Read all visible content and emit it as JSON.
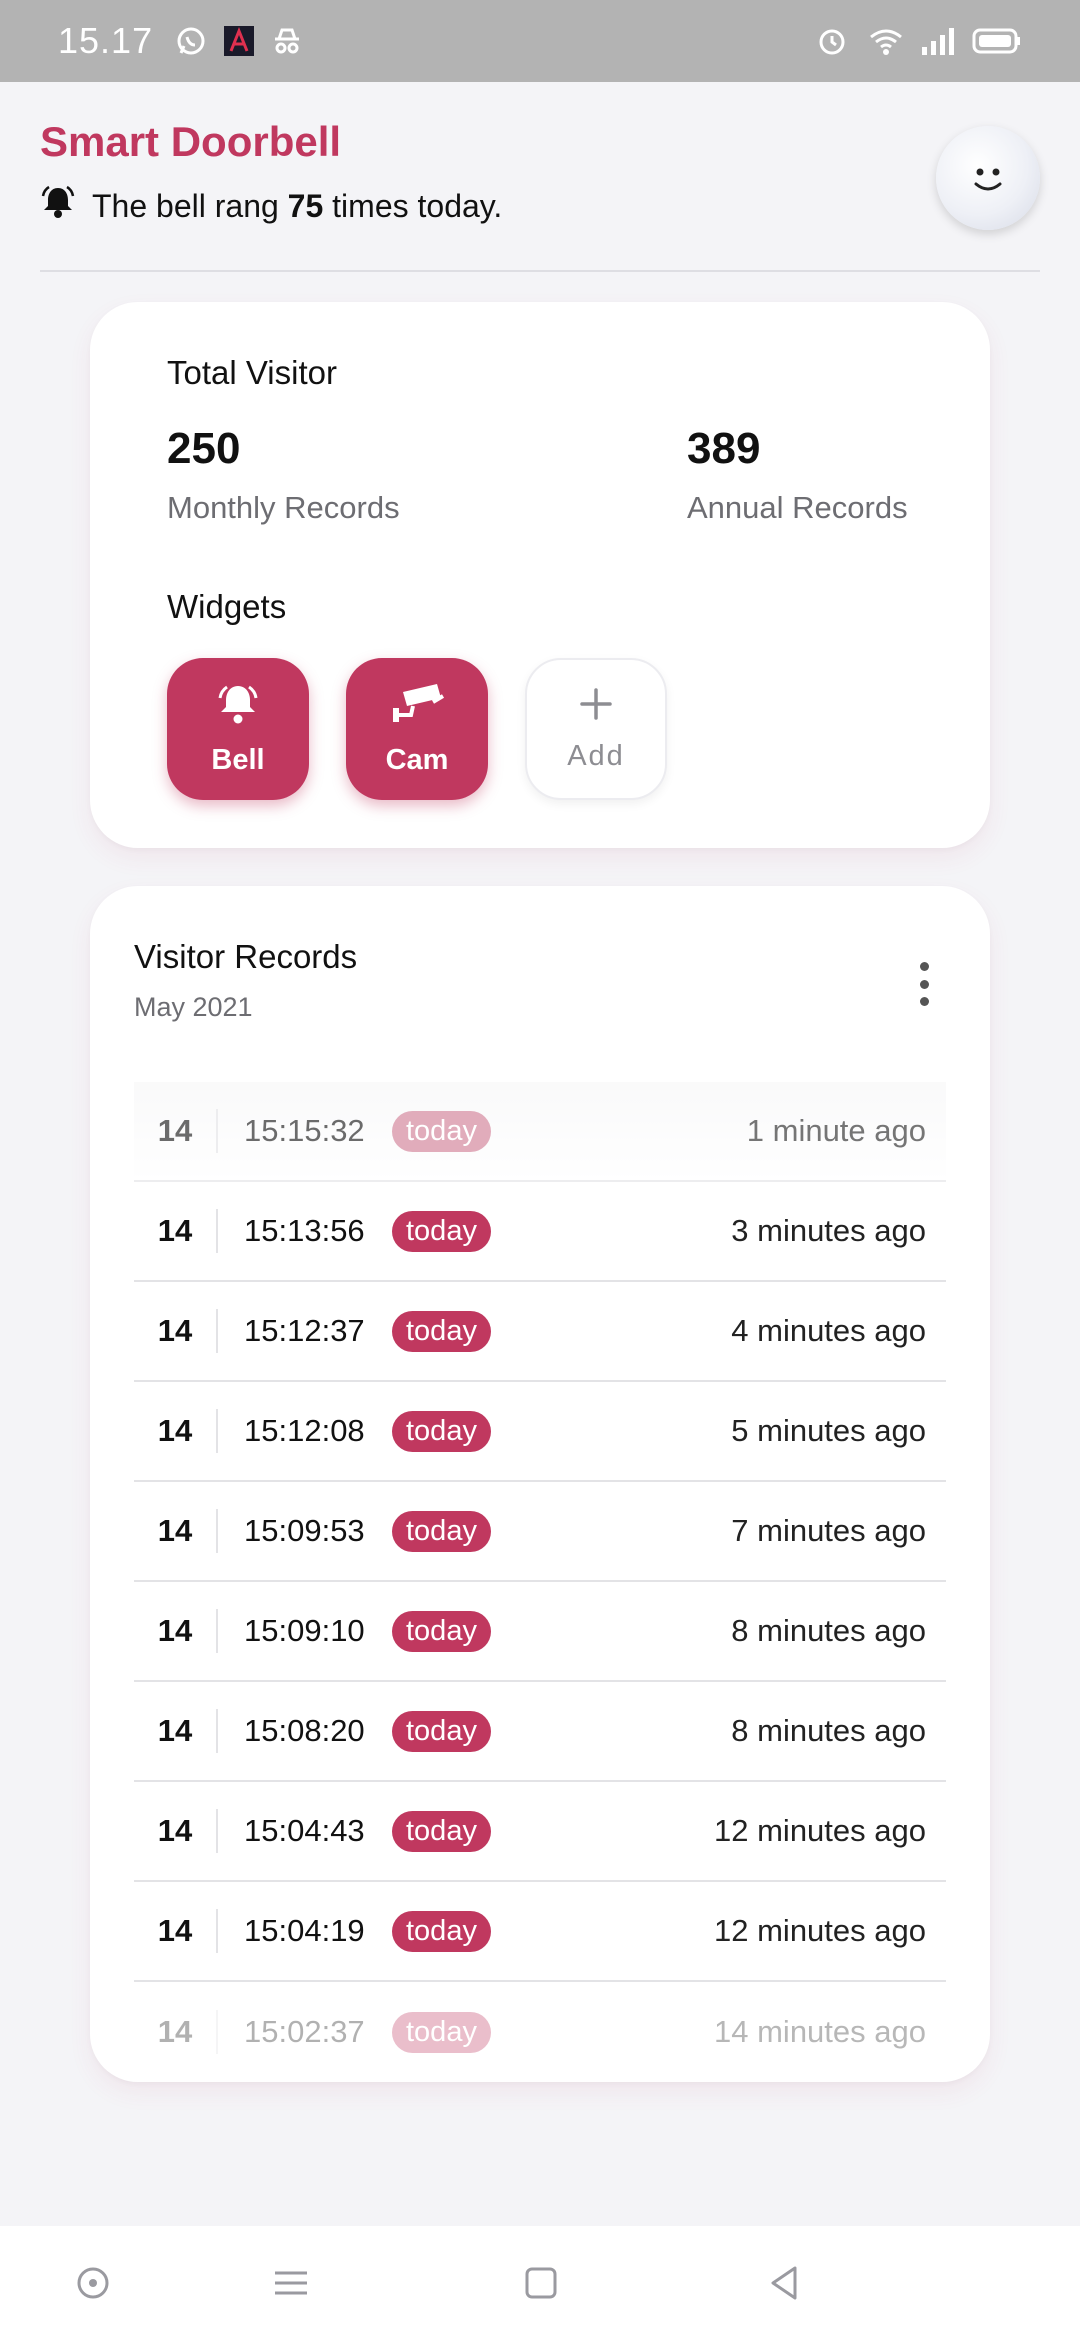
{
  "status_bar": {
    "time": "15.17",
    "left_icons": [
      "whatsapp-icon",
      "app-a-icon",
      "incognito-icon"
    ],
    "right_icons": [
      "alarm-icon",
      "wifi-icon",
      "signal-icon",
      "battery-icon"
    ]
  },
  "header": {
    "title": "Smart Doorbell",
    "bell_prefix": "The bell rang ",
    "bell_count": "75",
    "bell_suffix": " times today."
  },
  "total_visitor": {
    "title": "Total Visitor",
    "monthly_value": "250",
    "monthly_label": "Monthly Records",
    "annual_value": "389",
    "annual_label": "Annual Records"
  },
  "widgets": {
    "title": "Widgets",
    "items": [
      {
        "label": "Bell",
        "icon": "bell-icon"
      },
      {
        "label": "Cam",
        "icon": "cctv-camera-icon"
      },
      {
        "label": "Add",
        "icon": "plus-icon"
      }
    ]
  },
  "records": {
    "title": "Visitor Records",
    "subtitle": "May 2021",
    "rows": [
      {
        "day": "14",
        "time": "15:15:32",
        "badge": "today",
        "ago": "1 minute ago"
      },
      {
        "day": "14",
        "time": "15:13:56",
        "badge": "today",
        "ago": "3 minutes ago"
      },
      {
        "day": "14",
        "time": "15:12:37",
        "badge": "today",
        "ago": "4 minutes ago"
      },
      {
        "day": "14",
        "time": "15:12:08",
        "badge": "today",
        "ago": "5 minutes ago"
      },
      {
        "day": "14",
        "time": "15:09:53",
        "badge": "today",
        "ago": "7 minutes ago"
      },
      {
        "day": "14",
        "time": "15:09:10",
        "badge": "today",
        "ago": "8 minutes ago"
      },
      {
        "day": "14",
        "time": "15:08:20",
        "badge": "today",
        "ago": "8 minutes ago"
      },
      {
        "day": "14",
        "time": "15:04:43",
        "badge": "today",
        "ago": "12 minutes ago"
      },
      {
        "day": "14",
        "time": "15:04:19",
        "badge": "today",
        "ago": "12 minutes ago"
      },
      {
        "day": "14",
        "time": "15:02:37",
        "badge": "today",
        "ago": "14 minutes ago"
      }
    ]
  },
  "nav": [
    "circle-dot-icon",
    "menu-icon",
    "square-icon",
    "back-triangle-icon"
  ],
  "colors": {
    "accent": "#c0385f",
    "background": "#f4f4f7"
  }
}
